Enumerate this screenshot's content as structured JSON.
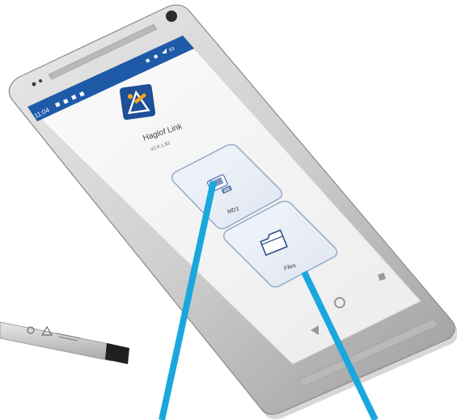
{
  "status_bar": {
    "time": "11:04",
    "battery": "93"
  },
  "app": {
    "name": "Haglof Link",
    "version": "v2.0.1.83",
    "accent_color": "#1e5aa8"
  },
  "buttons": {
    "md1_label": "MD1",
    "files_label": "Files"
  },
  "icons": {
    "app_logo": "haglof-logo-icon",
    "md1": "md1-device-icon",
    "files": "folder-icon",
    "nav_back": "back-triangle-icon",
    "nav_home": "home-circle-icon",
    "nav_recent": "recent-square-icon"
  },
  "pointer_color": "#1aa7de"
}
